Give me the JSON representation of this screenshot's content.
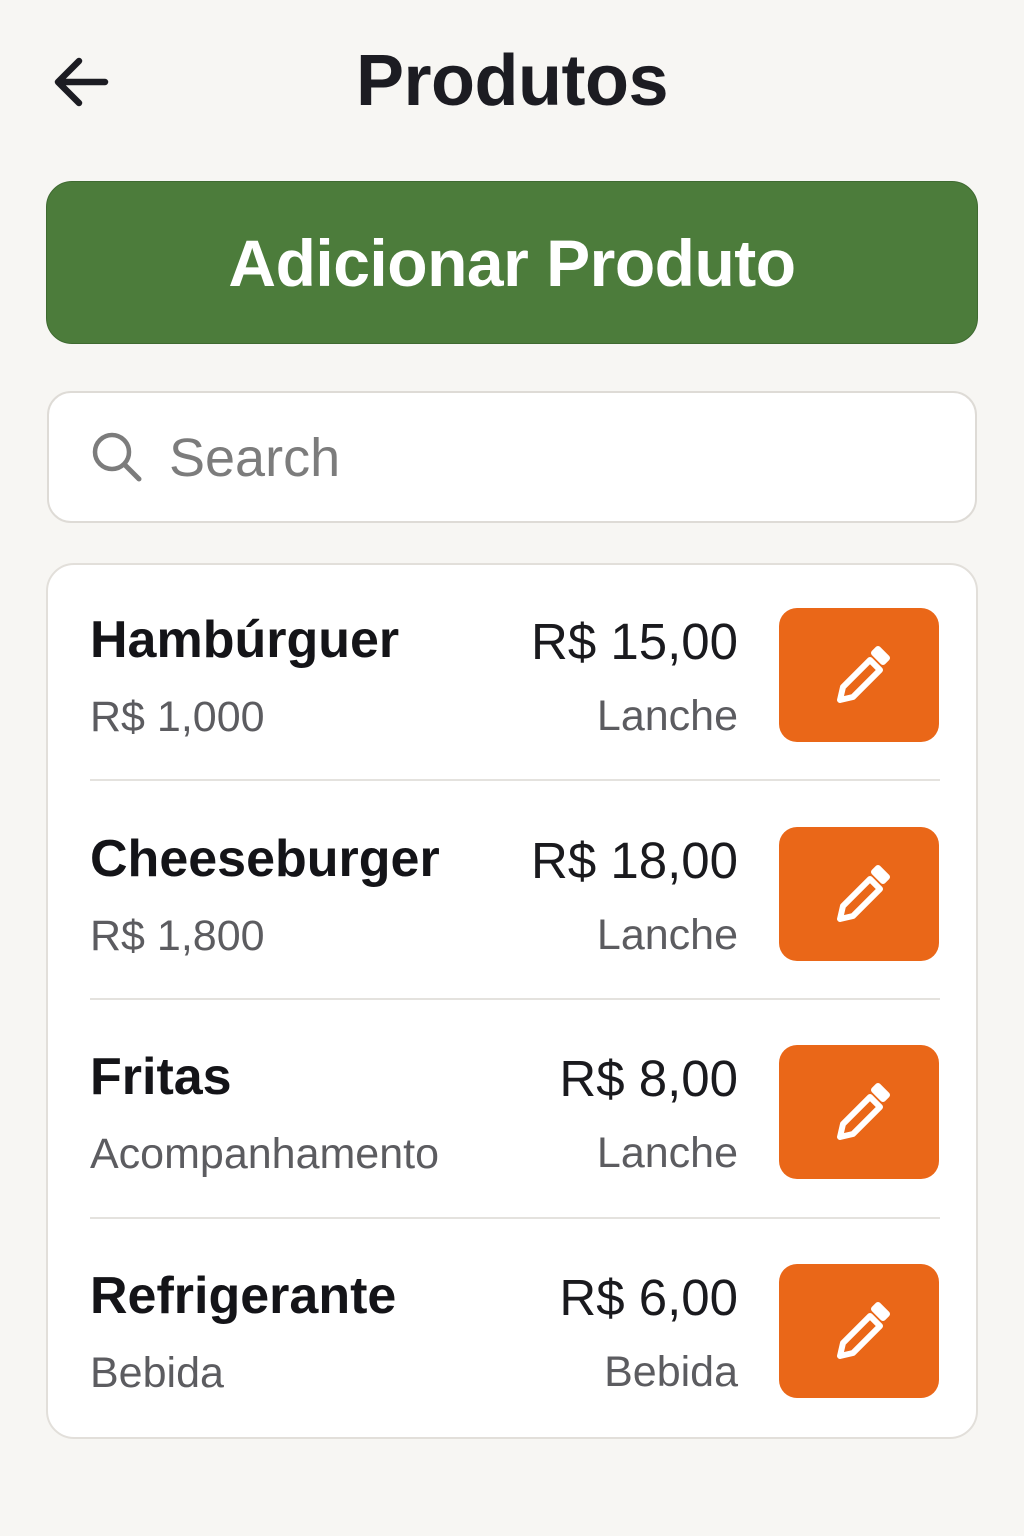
{
  "header": {
    "title": "Produtos",
    "back_icon": "arrow-left-icon"
  },
  "actions": {
    "add_label": "Adicionar Produto"
  },
  "search": {
    "placeholder": "Search",
    "value": "",
    "icon": "search-icon"
  },
  "colors": {
    "background": "#f7f6f3",
    "add_button": "#4c7c3b",
    "edit_button": "#ea6718",
    "text_primary": "#16161a",
    "text_secondary": "#5c5c60"
  },
  "products": [
    {
      "name": "Hambúrguer",
      "subtitle": "R$ 1,000",
      "price": "R$ 15,00",
      "category": "Lanche",
      "edit_icon": "pencil-icon"
    },
    {
      "name": "Cheeseburger",
      "subtitle": "R$ 1,800",
      "price": "R$ 18,00",
      "category": "Lanche",
      "edit_icon": "pencil-icon"
    },
    {
      "name": "Fritas",
      "subtitle": "Acompanhamento",
      "price": "R$ 8,00",
      "category": "Lanche",
      "edit_icon": "pencil-icon"
    },
    {
      "name": "Refrigerante",
      "subtitle": "Bebida",
      "price": "R$ 6,00",
      "category": "Bebida",
      "edit_icon": "pencil-icon"
    }
  ]
}
